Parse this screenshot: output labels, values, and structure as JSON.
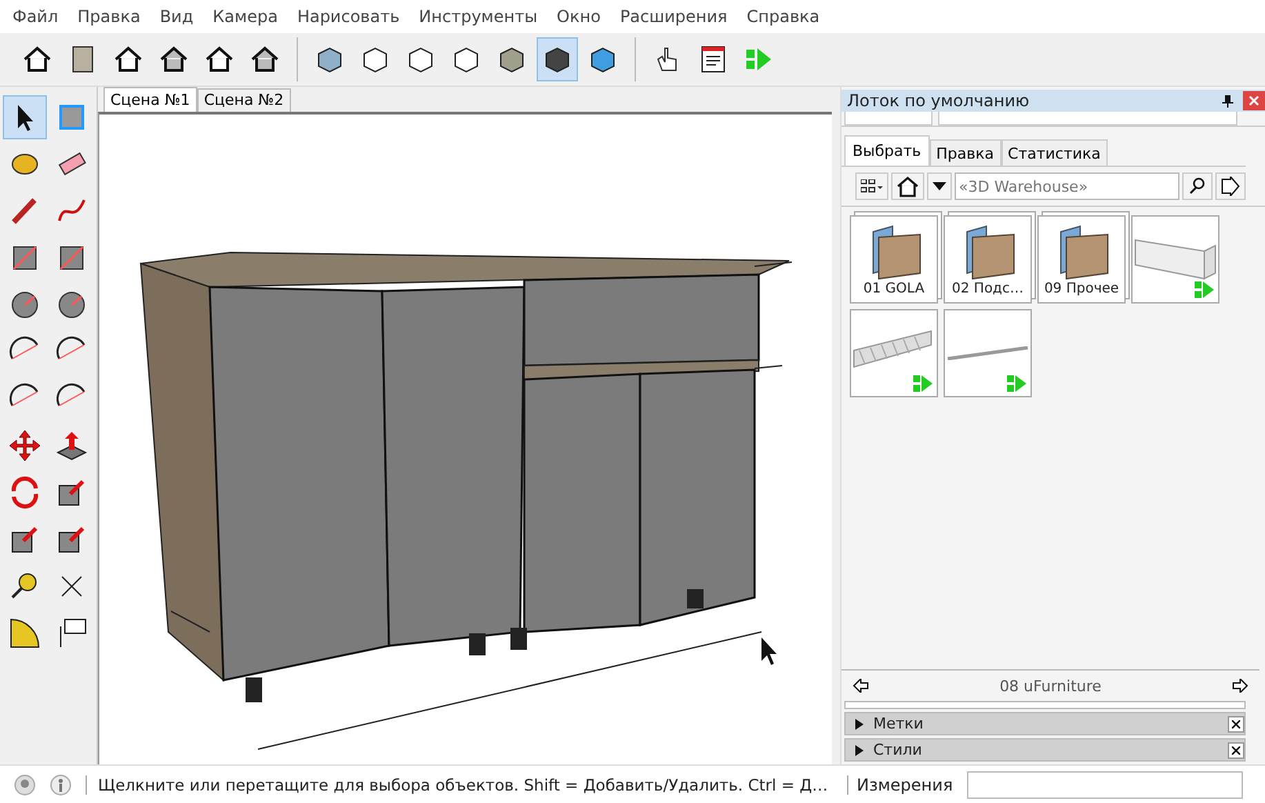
{
  "menu": [
    "Файл",
    "Правка",
    "Вид",
    "Камера",
    "Нарисовать",
    "Инструменты",
    "Окно",
    "Расширения",
    "Справка"
  ],
  "toolbar": [
    {
      "selected": false
    },
    {
      "selected": false
    },
    {
      "selected": false
    },
    {
      "selected": false
    },
    {
      "selected": false
    },
    {
      "selected": false
    },
    {
      "selected": false
    },
    {
      "selected": false
    },
    {
      "selected": false
    },
    {
      "selected": false
    },
    {
      "selected": false
    },
    {
      "selected": true
    },
    {
      "selected": false
    },
    {
      "selected": false
    },
    {
      "selected": false
    },
    {
      "selected": false
    }
  ],
  "scene_tabs": [
    {
      "label": "Сцена №1",
      "selected": true
    },
    {
      "label": "Сцена №2",
      "selected": false
    }
  ],
  "tools": [
    {
      "selected": true
    },
    {
      "selected": false
    },
    {
      "selected": false
    },
    {
      "selected": false
    },
    {
      "selected": false
    },
    {
      "selected": false
    },
    {
      "selected": false
    },
    {
      "selected": false
    },
    {
      "selected": false
    },
    {
      "selected": false
    },
    {
      "selected": false
    },
    {
      "selected": false
    },
    {
      "selected": false
    },
    {
      "selected": false
    },
    {
      "selected": false
    },
    {
      "selected": false
    },
    {
      "selected": false
    },
    {
      "selected": false
    },
    {
      "selected": false
    },
    {
      "selected": false
    },
    {
      "selected": false
    },
    {
      "selected": false
    },
    {
      "selected": false
    },
    {
      "selected": false
    }
  ],
  "tray": {
    "title": "Лоток по умолчанию",
    "tabs": [
      {
        "label": "Выбрать",
        "selected": true
      },
      {
        "label": "Правка",
        "selected": false
      },
      {
        "label": "Статистика",
        "selected": false
      }
    ],
    "search": {
      "placeholder": "«3D Warehouse»"
    },
    "items": [
      {
        "kind": "folder",
        "label": "01 GOLA"
      },
      {
        "kind": "folder",
        "label": "02 Подс…"
      },
      {
        "kind": "folder",
        "label": "09 Прочее"
      },
      {
        "kind": "component"
      },
      {
        "kind": "component"
      },
      {
        "kind": "component"
      }
    ],
    "collection": "08 uFurniture",
    "sections": [
      {
        "label": "Метки",
        "expanded": false
      },
      {
        "label": "Стили",
        "expanded": false
      }
    ]
  },
  "status_bar": {
    "hint": "Щелкните или перетащите для выбора объектов. Shift = Добавить/Удалить. Ctrl = Д…",
    "measurements_label": "Измерения"
  }
}
